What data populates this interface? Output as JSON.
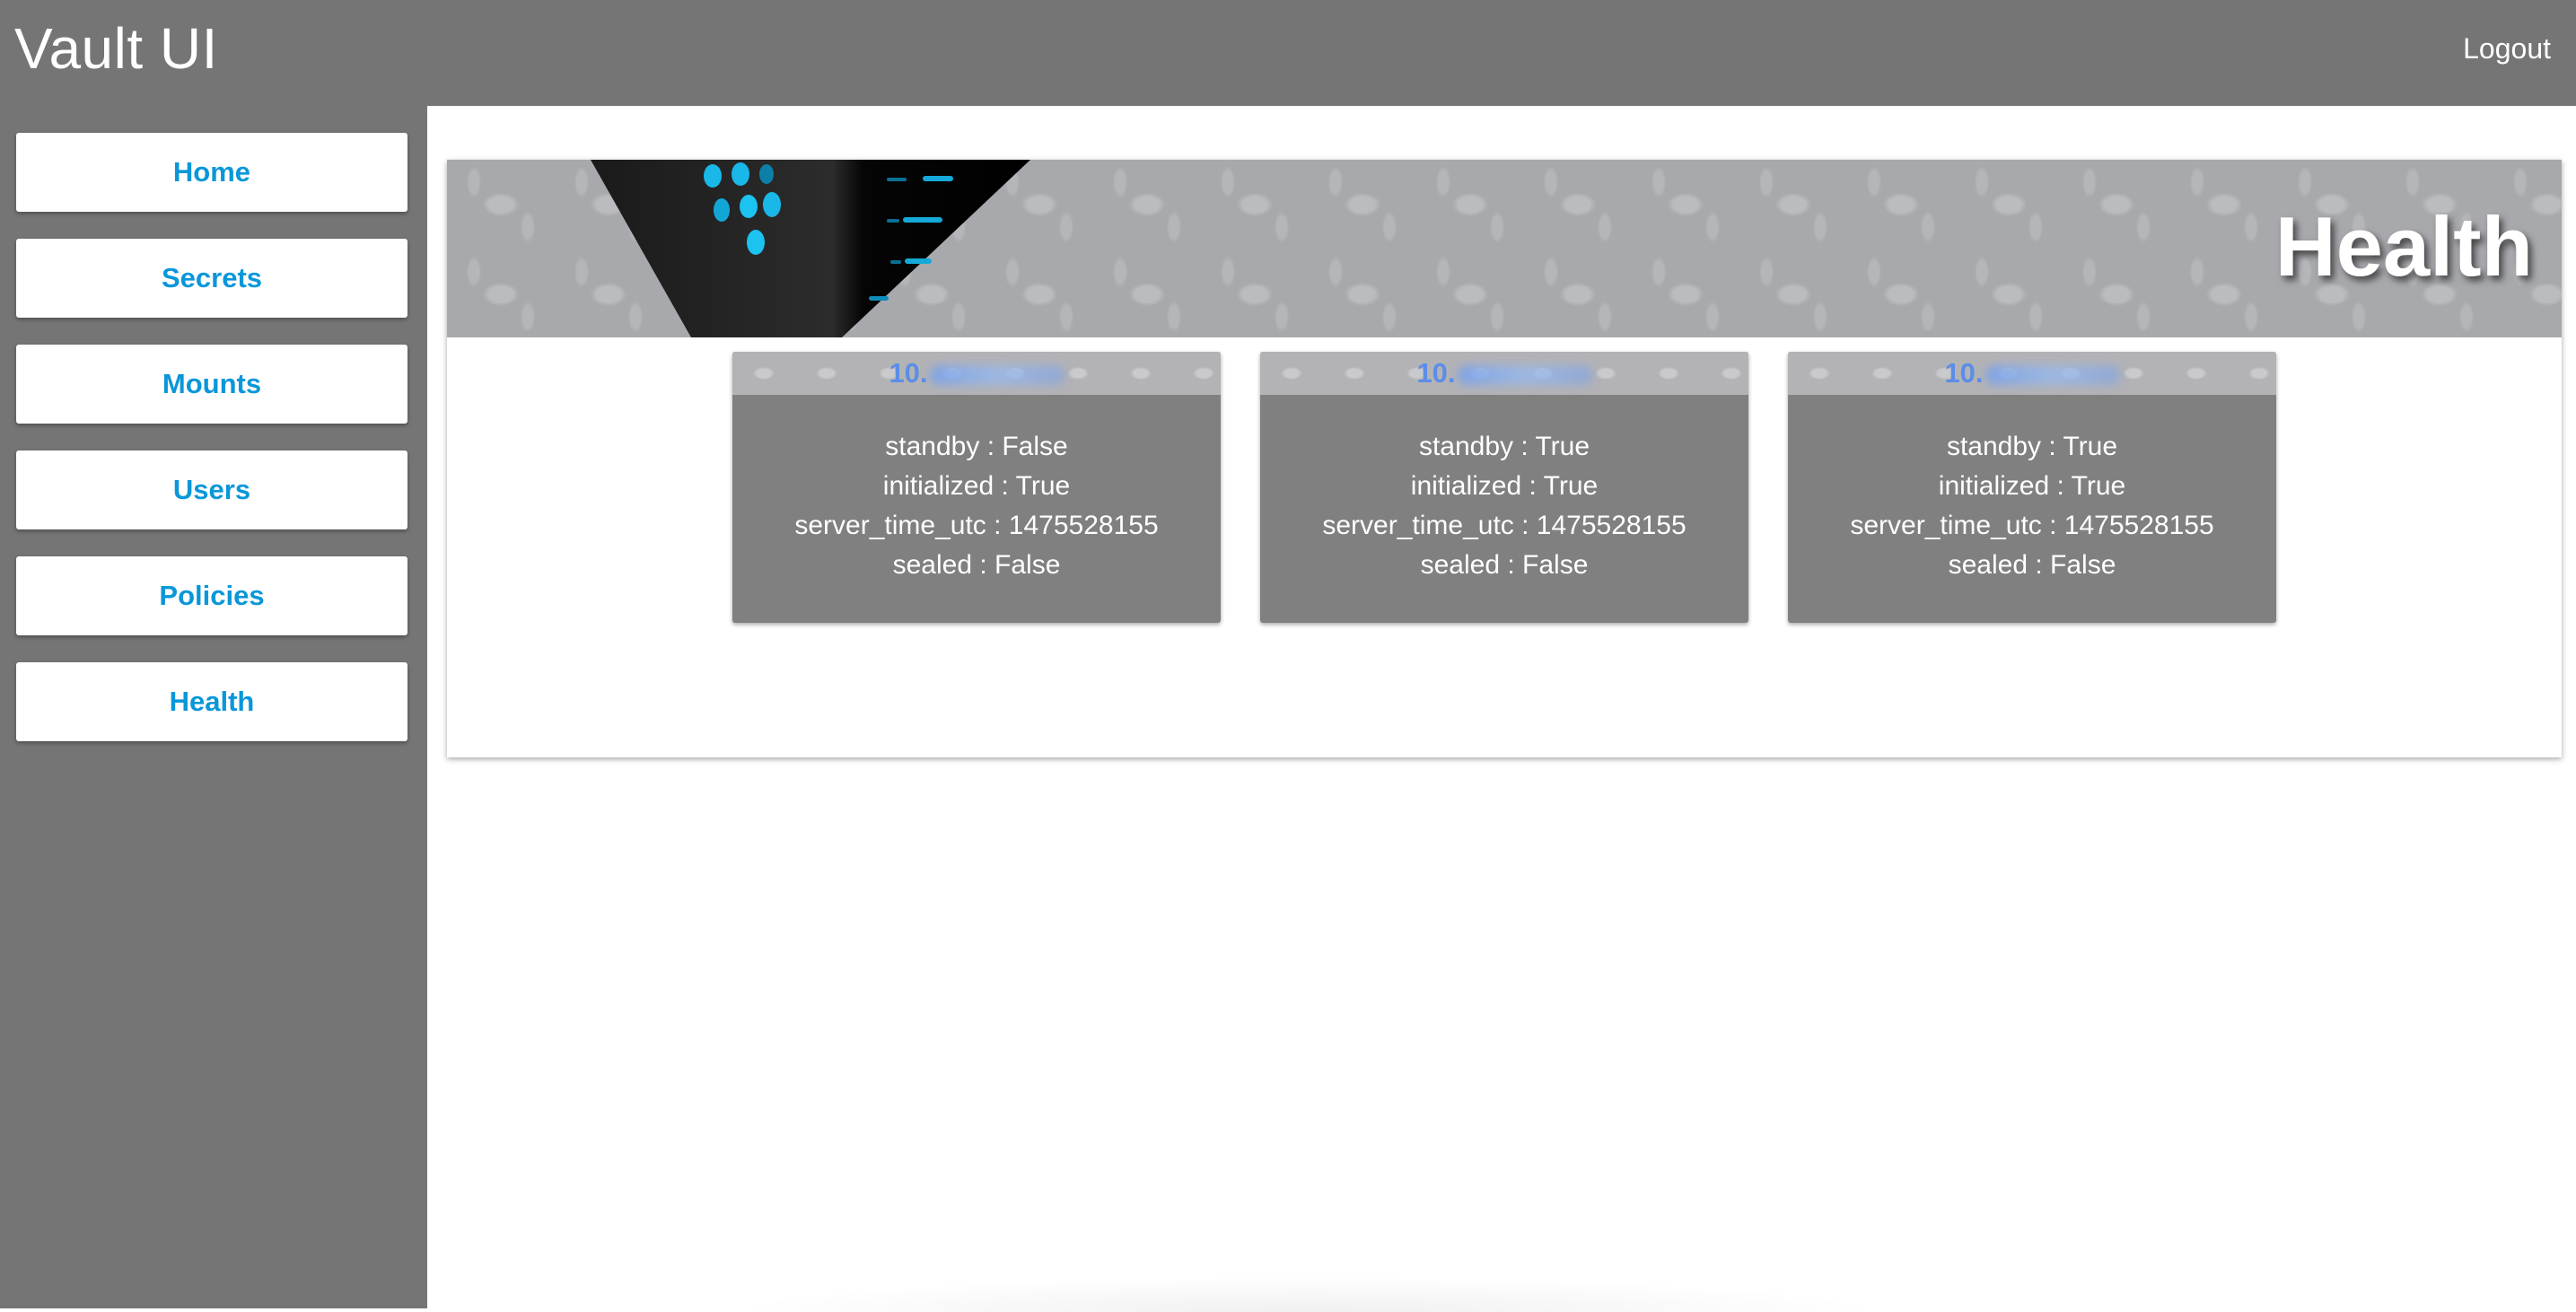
{
  "app": {
    "title": "Vault UI",
    "logout_label": "Logout"
  },
  "sidebar": {
    "items": [
      {
        "label": "Home"
      },
      {
        "label": "Secrets"
      },
      {
        "label": "Mounts"
      },
      {
        "label": "Users"
      },
      {
        "label": "Policies"
      },
      {
        "label": "Health"
      }
    ]
  },
  "page": {
    "banner_title": "Health"
  },
  "nodes": [
    {
      "ip_prefix": "10.",
      "standby": "standby : False",
      "initialized": "initialized : True",
      "server_time_utc": "server_time_utc : 1475528155",
      "sealed": "sealed : False"
    },
    {
      "ip_prefix": "10.",
      "standby": "standby : True",
      "initialized": "initialized : True",
      "server_time_utc": "server_time_utc : 1475528155",
      "sealed": "sealed : False"
    },
    {
      "ip_prefix": "10.",
      "standby": "standby : True",
      "initialized": "initialized : True",
      "server_time_utc": "server_time_utc : 1475528155",
      "sealed": "sealed : False"
    }
  ],
  "colors": {
    "appbar": "#757575",
    "nav_text": "#0a97d9",
    "card_bg": "#808080",
    "ip_text": "#5b8ee6"
  }
}
